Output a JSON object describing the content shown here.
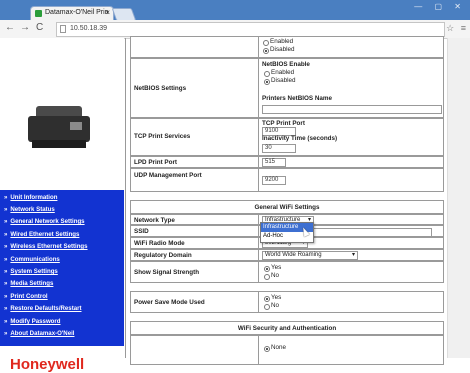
{
  "browser": {
    "tab_title": "Datamax-O'Neil Prin",
    "tab_close": "×",
    "window_controls": "— ▢ ✕",
    "url": "10.50.18.39",
    "toolbar_right": "☆ ≡"
  },
  "sidebar": {
    "items": [
      {
        "label": "Unit Information"
      },
      {
        "label": "Network Status"
      },
      {
        "label": "General Network Settings"
      },
      {
        "label": "Wired Ethernet Settings"
      },
      {
        "label": "Wireless Ethernet Settings"
      },
      {
        "label": "Communications"
      },
      {
        "label": "System Settings"
      },
      {
        "label": "Media Settings"
      },
      {
        "label": "Print Control"
      },
      {
        "label": "Restore Defaults/Restart"
      },
      {
        "label": "Modify Password"
      },
      {
        "label": "About Datamax-O'Neil"
      }
    ],
    "logo": "Honeywell",
    "logo_color": "#e0281e",
    "nav_bg": "#1233d1"
  },
  "content": {
    "top_options": {
      "enabled": "Enabled",
      "disabled": "Disabled"
    },
    "netbios": {
      "label": "NetBIOS Settings",
      "enable_title": "NetBIOS Enable",
      "enabled": "Enabled",
      "disabled": "Disabled",
      "name_label": "Printers NetBIOS Name"
    },
    "tcp": {
      "label": "TCP Print Services",
      "port_label": "TCP Print Port",
      "port_value": "9100",
      "inactivity_label": "Inactivity Time (seconds)",
      "inactivity_value": "30"
    },
    "lpd": {
      "label": "LPD Print Port",
      "value": "515"
    },
    "udp": {
      "label": "UDP Management Port",
      "value": "9200"
    },
    "wifi": {
      "header": "General WiFi Settings",
      "network_type_label": "Network Type",
      "network_type_value": "Infrastructure",
      "dropdown_options": [
        "Infrastructure",
        "Ad-Hoc"
      ],
      "ssid_label": "SSID",
      "radio_mode_label": "WiFi Radio Mode",
      "radio_mode_value": "802.11b/g",
      "reg_domain_label": "Regulatory Domain",
      "reg_domain_value": "World Wide Roaming",
      "signal_label": "Show Signal Strength",
      "signal_yes": "Yes",
      "signal_no": "No",
      "psm_label": "Power Save Mode Used",
      "psm_yes": "Yes",
      "psm_no": "No"
    },
    "security": {
      "header": "WiFi Security and Authentication",
      "none_option": "None"
    }
  }
}
